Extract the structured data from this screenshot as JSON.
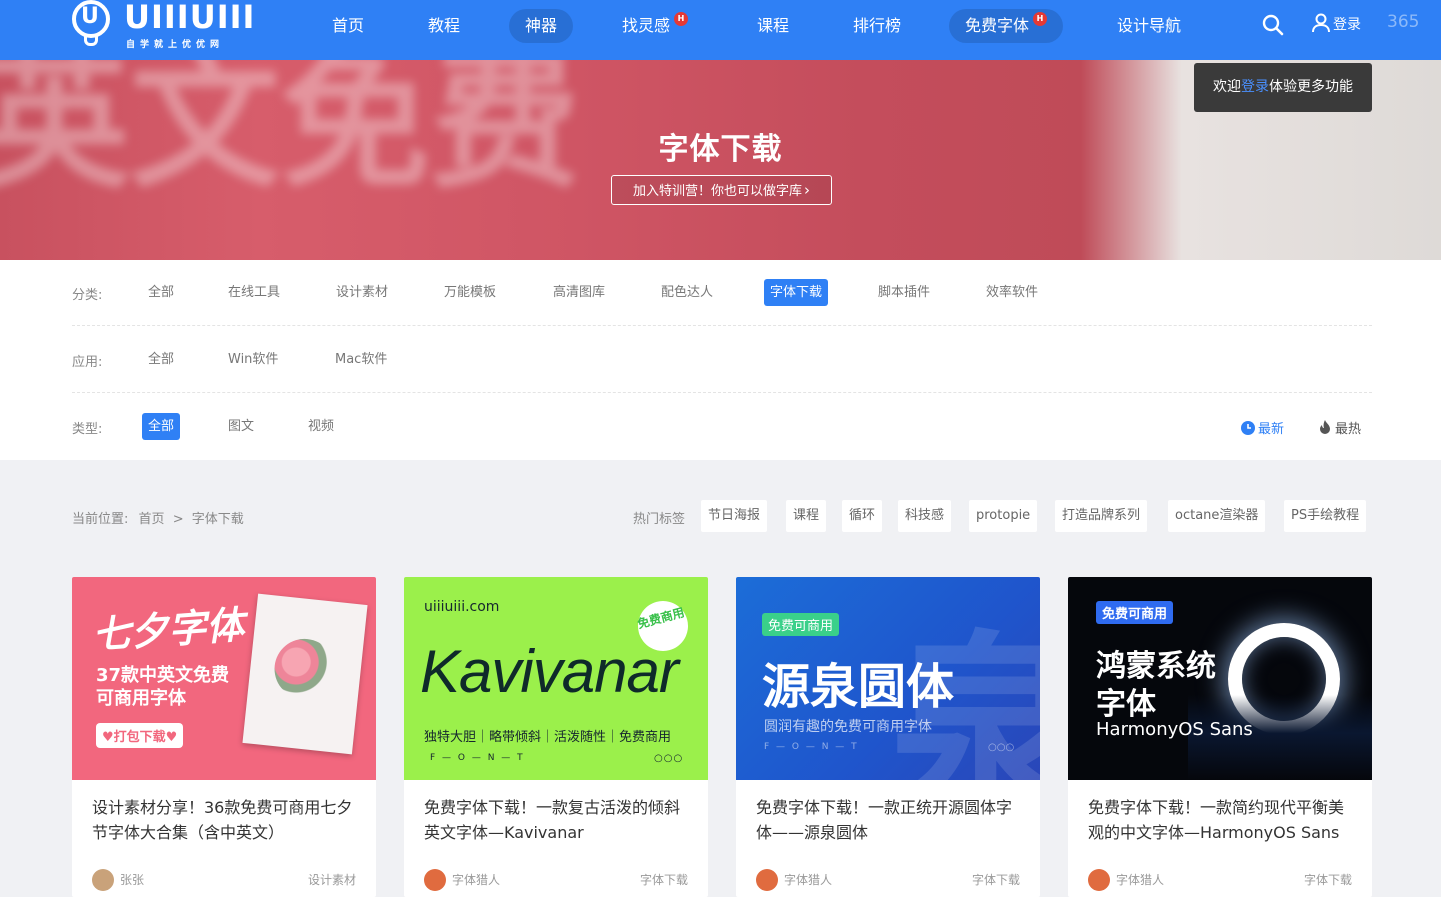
{
  "nav": {
    "logo_text": "UIIIUIII",
    "logo_sub": "自学就上优优网",
    "items": [
      {
        "label": "首页"
      },
      {
        "label": "教程"
      },
      {
        "label": "神器"
      },
      {
        "label": "找灵感",
        "badge": "H"
      },
      {
        "label": "课程"
      },
      {
        "label": "排行榜"
      },
      {
        "label": "免费字体",
        "badge": "H"
      },
      {
        "label": "设计导航"
      }
    ],
    "login_label": "登录",
    "extra": "365"
  },
  "tooltip": {
    "pre": "欢迎",
    "link": "登录",
    "post": "体验更多功能"
  },
  "banner": {
    "title": "字体下载",
    "button": "加入特训营！你也可以做字库"
  },
  "filters": {
    "category": {
      "label": "分类:",
      "items": [
        "全部",
        "在线工具",
        "设计素材",
        "万能模板",
        "高清图库",
        "配色达人",
        "字体下载",
        "脚本插件",
        "效率软件"
      ],
      "active": "字体下载"
    },
    "app": {
      "label": "应用:",
      "items": [
        "全部",
        "Win软件",
        "Mac软件"
      ]
    },
    "type": {
      "label": "类型:",
      "items": [
        "全部",
        "图文",
        "视频"
      ],
      "active": "全部"
    },
    "sort": {
      "newest": "最新",
      "hottest": "最热"
    }
  },
  "breadcrumb": {
    "label": "当前位置:",
    "home": "首页",
    "sep": ">",
    "current": "字体下载"
  },
  "hot_tags": {
    "label": "热门标签",
    "items": [
      "节日海报",
      "课程",
      "循环",
      "科技感",
      "protopie",
      "打造品牌系列",
      "octane渲染器",
      "PS手绘教程"
    ]
  },
  "cards": [
    {
      "title": "设计素材分享！36款免费可商用七夕节字体大合集（含中英文）",
      "author": "张张",
      "category": "设计素材",
      "thumb": {
        "headline": "七夕字体",
        "line1": "37款中英文免费",
        "line2": "可商用字体",
        "cta": "♥打包下载♥"
      }
    },
    {
      "title": "免费字体下载！一款复古活泼的倾斜英文字体—Kavivanar",
      "author": "字体猎人",
      "category": "字体下载",
      "thumb": {
        "site": "uiiiuiii.com",
        "badge": "免费商用",
        "headline": "Kavivanar",
        "tags": "独特大胆｜略带倾斜｜活泼随性｜免费商用",
        "font": "F — O — N — T"
      }
    },
    {
      "title": "免费字体下载！一款正统开源圆体字体——源泉圆体",
      "author": "字体猎人",
      "category": "字体下载",
      "thumb": {
        "badge": "免费可商用",
        "headline": "源泉圆体",
        "sub": "圆润有趣的免费可商用字体",
        "font": "F — O — N — T"
      }
    },
    {
      "title": "免费字体下载！一款简约现代平衡美观的中文字体—HarmonyOS Sans",
      "author": "字体猎人",
      "category": "字体下载",
      "thumb": {
        "badge": "免费可商用",
        "headline1": "鸿蒙系统",
        "headline2": "字体",
        "sub": "HarmonyOS Sans"
      }
    }
  ]
}
